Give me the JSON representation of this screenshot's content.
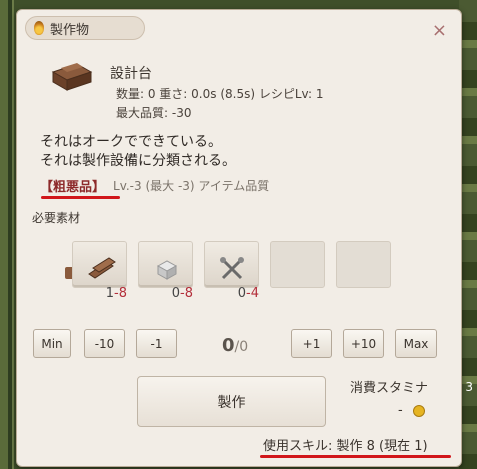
{
  "window": {
    "title": "製作物",
    "close": "×"
  },
  "item": {
    "name": "設計台",
    "stats_line1": "数量: 0  重さ: 0.0s (8.5s)  レシピLv: 1",
    "stats_line2": "最大品質: -30"
  },
  "description": {
    "line1": "それはオークでできている。",
    "line2": "それは製作設備に分類される。"
  },
  "quality": {
    "name": "【粗悪品】",
    "detail": "Lv.-3 (最大 -3) アイテム品質"
  },
  "materials": {
    "label": "必要素材",
    "slots": [
      {
        "icon": "wood-planks-icon",
        "have": "1",
        "need": "8"
      },
      {
        "icon": "stone-block-icon",
        "have": "0",
        "need": "8"
      },
      {
        "icon": "crossed-tools-icon",
        "have": "0",
        "need": "4"
      }
    ]
  },
  "quantity": {
    "buttons": [
      "Min",
      "-10",
      "-1",
      "+1",
      "+10",
      "Max"
    ],
    "current": "0",
    "max": "/0"
  },
  "craft": {
    "label": "製作"
  },
  "stamina": {
    "label": "消費スタミナ",
    "value": "-"
  },
  "skill": {
    "text": "使用スキル: 製作 8 (現在 1)"
  },
  "background": {
    "number": "3"
  }
}
